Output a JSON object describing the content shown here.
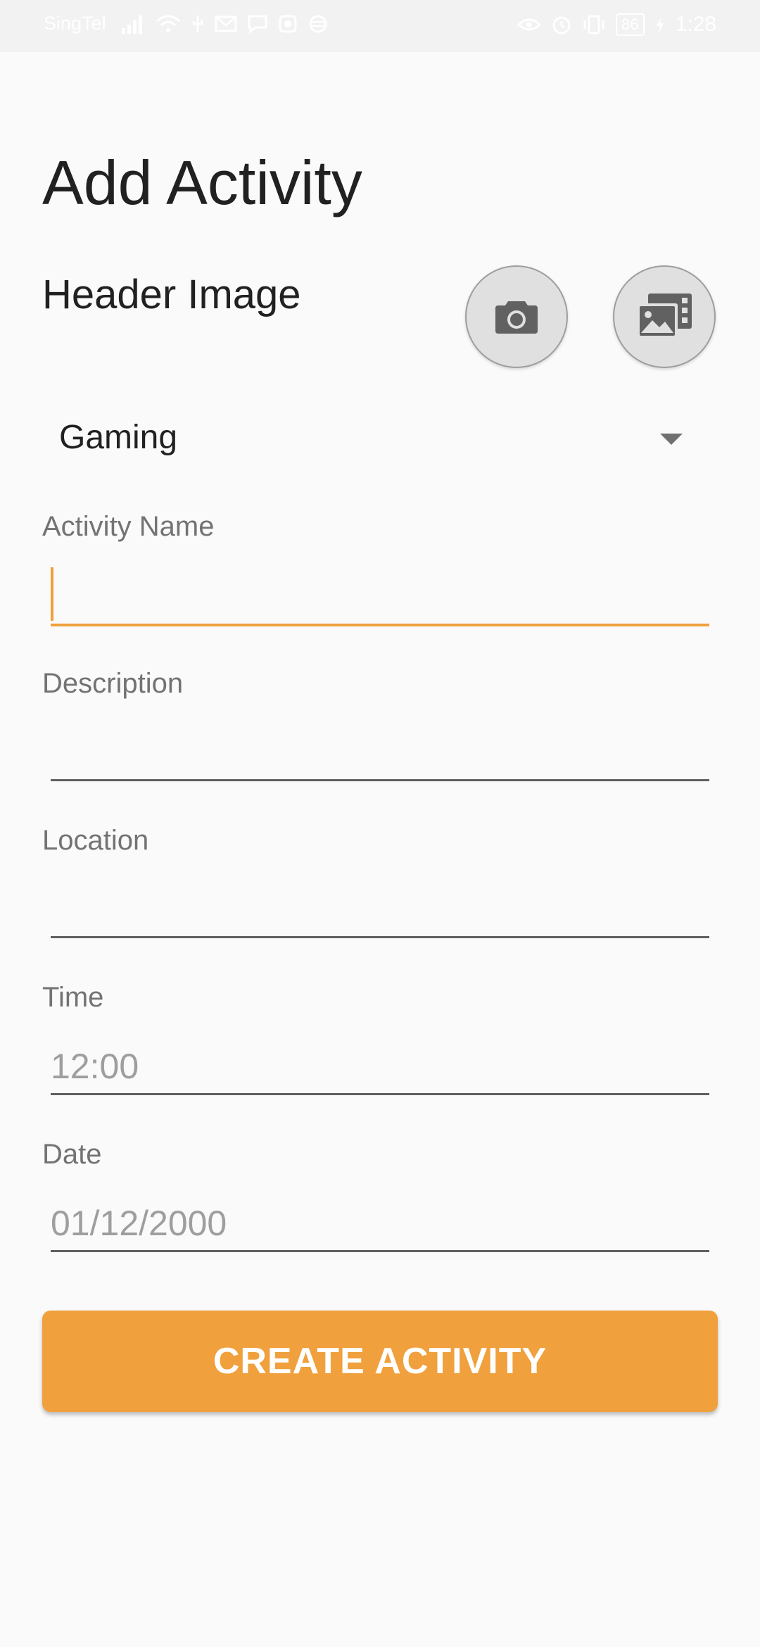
{
  "status_bar": {
    "carrier": "SingTel",
    "battery": "86",
    "time": "1:28",
    "left_icons": [
      "signal-icon",
      "wifi-icon",
      "usb-icon",
      "gmail-icon",
      "chat-icon",
      "app-icon",
      "data-icon"
    ],
    "right_icons": [
      "eye-icon",
      "alarm-icon",
      "vibrate-icon",
      "battery-icon",
      "charging-icon"
    ]
  },
  "page": {
    "title": "Add Activity",
    "header_image_label": "Header Image",
    "camera_icon": "camera-icon",
    "gallery_icon": "gallery-icon"
  },
  "category": {
    "selected": "Gaming"
  },
  "form": {
    "activity_name": {
      "label": "Activity Name",
      "value": "",
      "placeholder": ""
    },
    "description": {
      "label": "Description",
      "value": "",
      "placeholder": ""
    },
    "location": {
      "label": "Location",
      "value": "",
      "placeholder": ""
    },
    "time": {
      "label": "Time",
      "value": "",
      "placeholder": "12:00"
    },
    "date": {
      "label": "Date",
      "value": "",
      "placeholder": "01/12/2000"
    }
  },
  "actions": {
    "create_label": "CREATE ACTIVITY"
  },
  "colors": {
    "accent": "#f0a03c",
    "background": "#fafafa",
    "label": "#737373",
    "text": "#212121"
  }
}
